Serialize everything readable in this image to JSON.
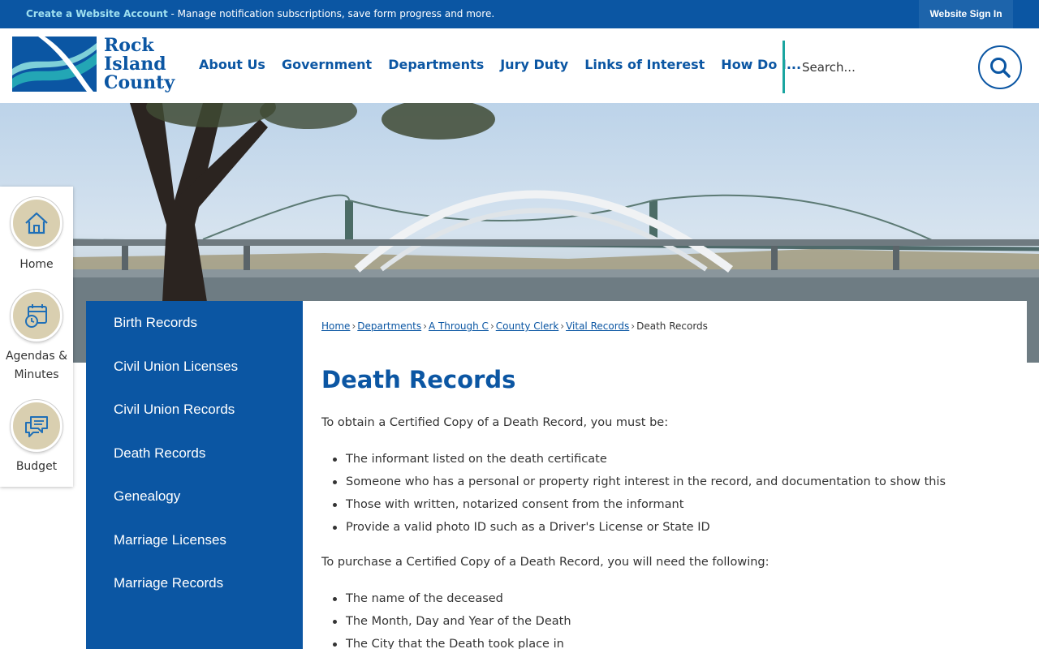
{
  "topbar": {
    "create_account": "Create a Website Account",
    "message": " - Manage notification subscriptions, save form progress and more.",
    "signin": "Website Sign In"
  },
  "logo": {
    "line1": "Rock",
    "line2": "Island",
    "line3": "County"
  },
  "nav": [
    "About Us",
    "Government",
    "Departments",
    "Jury Duty",
    "Links of Interest",
    "How Do I..."
  ],
  "search": {
    "placeholder": "Search..."
  },
  "quick_links": [
    {
      "label": "Home",
      "icon": "home-icon"
    },
    {
      "label_line1": "Agendas &",
      "label_line2": "Minutes",
      "icon": "calendar-clock-icon"
    },
    {
      "label": "Budget",
      "icon": "chat-bubbles-icon"
    }
  ],
  "sidenav": [
    "Birth Records",
    "Civil Union Licenses",
    "Civil Union Records",
    "Death Records",
    "Genealogy",
    "Marriage Licenses",
    "Marriage Records"
  ],
  "breadcrumb": {
    "links": [
      "Home",
      "Departments",
      "A Through C",
      "County Clerk",
      "Vital Records"
    ],
    "current": "Death Records"
  },
  "page": {
    "title": "Death Records",
    "intro1": "To obtain a Certified Copy of a Death Record, you must be:",
    "list1": [
      "The informant listed on the death certificate",
      "Someone who has a personal or property right interest in the record, and documentation to show this",
      "Those with written, notarized consent from the informant",
      "Provide a valid photo ID such as a Driver's License or State ID"
    ],
    "intro2": "To purchase a Certified Copy of a Death Record, you will need the following:",
    "list2": [
      "The name of the deceased",
      "The Month, Day and Year of the Death",
      "The City that the Death took place in"
    ]
  },
  "colors": {
    "brand_blue": "#0b56a3",
    "teal": "#1aa5a0",
    "tan": "#d9cfb0"
  }
}
